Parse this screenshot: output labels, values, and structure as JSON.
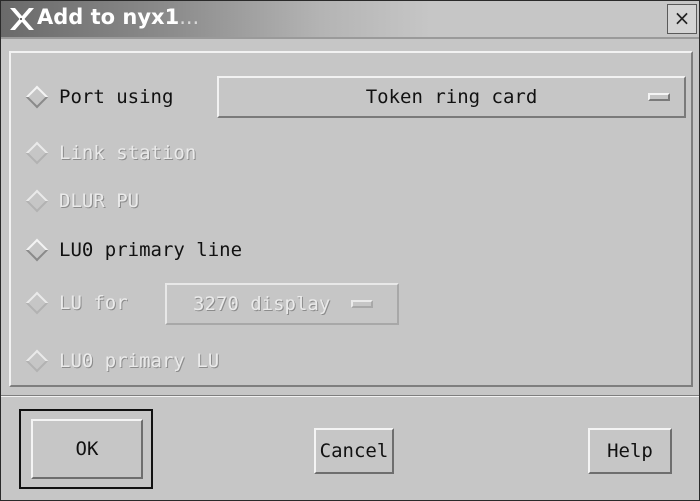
{
  "window": {
    "title": "Add to nyx1",
    "title_suffix": "...",
    "close_glyph": "×",
    "logo_icon": "x-window-logo-icon"
  },
  "options": [
    {
      "label": "Port using",
      "enabled": true
    },
    {
      "label": "Link station",
      "enabled": false
    },
    {
      "label": "DLUR PU",
      "enabled": false
    },
    {
      "label": "LU0 primary line",
      "enabled": true
    },
    {
      "label": "LU for",
      "enabled": false
    },
    {
      "label": "LU0 primary LU",
      "enabled": false
    }
  ],
  "port_menu": {
    "value": "Token ring card",
    "enabled": true
  },
  "lu_menu": {
    "value": "3270 display",
    "enabled": false
  },
  "buttons": {
    "ok": "OK",
    "cancel": "Cancel",
    "help": "Help"
  }
}
